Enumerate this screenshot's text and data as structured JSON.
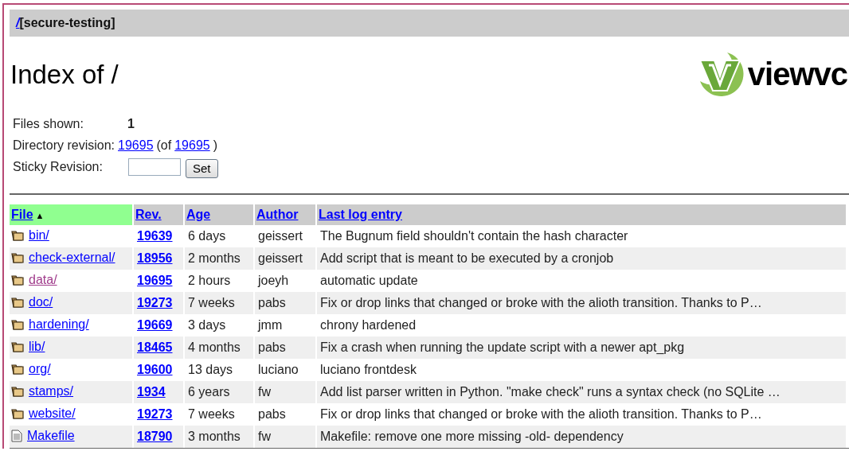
{
  "breadcrumb": {
    "root_link": "/",
    "repository": "[secure-testing]"
  },
  "title": "Index of /",
  "logo": {
    "text": "viewvc"
  },
  "info": {
    "files_shown_label": "Files shown:",
    "files_shown": "1",
    "directory_revision_label": "Directory revision:",
    "directory_revision": "19695",
    "of_prefix": "(of",
    "head_revision": "19695",
    "of_suffix": ")",
    "sticky_revision_label": "Sticky Revision:",
    "set_button": "Set"
  },
  "table": {
    "columns": [
      {
        "label": "File",
        "selected": true,
        "sort_arrow": "▲"
      },
      {
        "label": "Rev.",
        "selected": false
      },
      {
        "label": "Age",
        "selected": false
      },
      {
        "label": "Author",
        "selected": false
      },
      {
        "label": "Last log entry",
        "selected": false
      }
    ],
    "rows": [
      {
        "kind": "folder",
        "name": "bin/",
        "visited": false,
        "rev": "19639",
        "age": "6 days",
        "author": "geissert",
        "log": "The Bugnum field shouldn't contain the hash character"
      },
      {
        "kind": "folder",
        "name": "check-external/",
        "visited": false,
        "rev": "18956",
        "age": "2 months",
        "author": "geissert",
        "log": "Add script that is meant to be executed by a cronjob"
      },
      {
        "kind": "folder",
        "name": "data/",
        "visited": true,
        "rev": "19695",
        "age": "2 hours",
        "author": "joeyh",
        "log": "automatic update"
      },
      {
        "kind": "folder",
        "name": "doc/",
        "visited": false,
        "rev": "19273",
        "age": "7 weeks",
        "author": "pabs",
        "log": "Fix or drop links that changed or broke with the alioth transition. Thanks to P…"
      },
      {
        "kind": "folder",
        "name": "hardening/",
        "visited": false,
        "rev": "19669",
        "age": "3 days",
        "author": "jmm",
        "log": "chrony hardened"
      },
      {
        "kind": "folder",
        "name": "lib/",
        "visited": false,
        "rev": "18465",
        "age": "4 months",
        "author": "pabs",
        "log": "Fix a crash when running the update script with a newer apt_pkg"
      },
      {
        "kind": "folder",
        "name": "org/",
        "visited": false,
        "rev": "19600",
        "age": "13 days",
        "author": "luciano",
        "log": "luciano frontdesk"
      },
      {
        "kind": "folder",
        "name": "stamps/",
        "visited": false,
        "rev": "1934",
        "age": "6 years",
        "author": "fw",
        "log": "Add list parser written in Python. \"make check\" runs a syntax check (no SQLite …"
      },
      {
        "kind": "folder",
        "name": "website/",
        "visited": false,
        "rev": "19273",
        "age": "7 weeks",
        "author": "pabs",
        "log": "Fix or drop links that changed or broke with the alioth transition. Thanks to P…"
      },
      {
        "kind": "file",
        "name": "Makefile",
        "visited": false,
        "rev": "18790",
        "age": "3 months",
        "author": "fw",
        "log": "Makefile: remove one more missing -old- dependency"
      }
    ]
  }
}
